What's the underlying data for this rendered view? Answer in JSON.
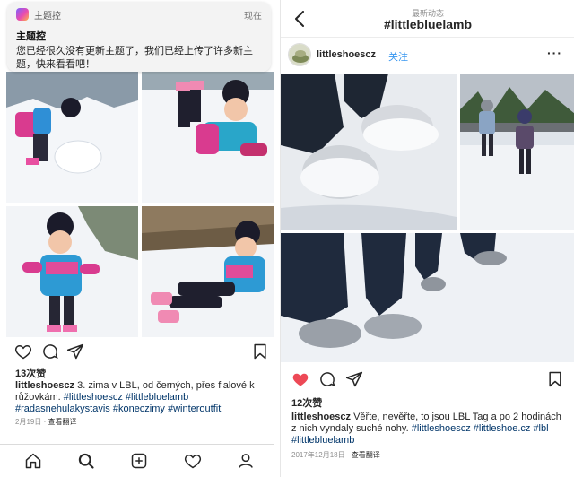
{
  "left_post": {
    "notification": {
      "app_name": "主题控",
      "time": "现在",
      "title": "主题控",
      "body": "您已经很久没有更新主题了，我们已经上传了许多新主题，快来看看吧！",
      "icon": "app-icon"
    },
    "actions": {
      "like_icon": "heart-outline-icon",
      "comment_icon": "comment-icon",
      "share_icon": "paper-plane-icon",
      "save_icon": "bookmark-icon"
    },
    "likes": "13次赞",
    "caption": {
      "username": "littleshoescz",
      "text": " 3. zima v LBL, od černých, přes fialové k růžovkám. ",
      "hashtags": "#littleshoescz #littlebluelamb #radasnehulakystavis #koneczimy #winteroutfit"
    },
    "date": "2月19日",
    "translate": "查看翻译",
    "tabbar": [
      "home-icon",
      "search-icon",
      "add-icon",
      "heart-icon",
      "profile-icon"
    ]
  },
  "right_post": {
    "nav": {
      "subtitle": "最新动态",
      "title": "#littlebluelamb",
      "back_icon": "back-chevron-icon"
    },
    "header": {
      "username": "littleshoescz",
      "follow": "关注",
      "more": "···"
    },
    "actions": {
      "like_icon": "heart-filled-icon",
      "comment_icon": "comment-icon",
      "share_icon": "paper-plane-icon",
      "save_icon": "bookmark-icon"
    },
    "likes": "12次赞",
    "caption": {
      "username": "littleshoescz",
      "text": " Věřte, nevěřte, to jsou LBL Tag a po 2 hodinách z nich vyndaly suché nohy. ",
      "hashtags": "#littleshoescz #littleshoe.cz #lbl #littlebluelamb"
    },
    "date": "2017年12月18日",
    "translate": "查看翻译"
  },
  "colors": {
    "accent": "#3897f0",
    "like_red": "#ed4956",
    "hashtag": "#003569",
    "muted": "#8e8e8e"
  }
}
